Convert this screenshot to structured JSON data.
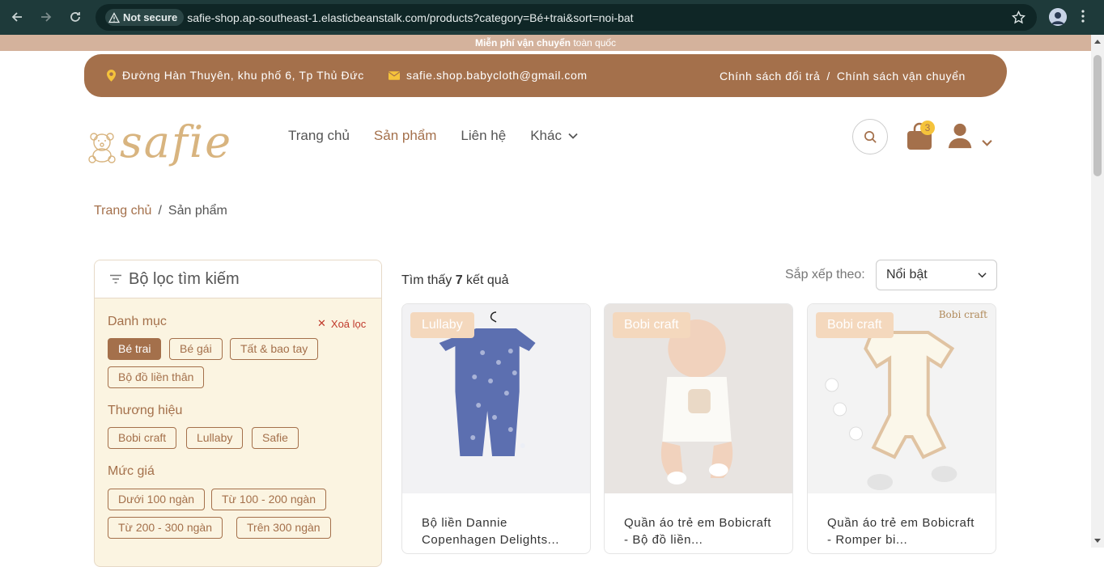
{
  "browser": {
    "security": "Not secure",
    "url": "safie-shop.ap-southeast-1.elasticbeanstalk.com/products?category=Bé+trai&sort=noi-bat"
  },
  "banner": {
    "bold": "Miễn phí vận chuyển",
    "rest": "toàn quốc"
  },
  "contact": {
    "address": "Đường Hàn Thuyên, khu phố 6, Tp Thủ Đức",
    "email": "safie.shop.babycloth@gmail.com",
    "return_policy": "Chính sách đổi trả",
    "separator": "/",
    "shipping_policy": "Chính sách vận chuyển"
  },
  "logo": "safie",
  "menu": {
    "home": "Trang chủ",
    "products": "Sản phẩm",
    "contact": "Liên hệ",
    "more": "Khác"
  },
  "cart": {
    "count": "3"
  },
  "breadcrumb": {
    "home": "Trang chủ",
    "sep": "/",
    "current": "Sản phẩm"
  },
  "filter": {
    "title": "Bộ lọc tìm kiếm",
    "category_title": "Danh mục",
    "clear": "Xoá lọc",
    "categories": [
      "Bé trai",
      "Bé gái",
      "Tất & bao tay",
      "Bộ đồ liền thân"
    ],
    "brand_title": "Thương hiệu",
    "brands": [
      "Bobi craft",
      "Lullaby",
      "Safie"
    ],
    "price_title": "Mức giá",
    "prices": [
      "Dưới 100 ngàn",
      "Từ 100 - 200 ngàn",
      "Từ 200 - 300 ngàn",
      "Trên 300 ngàn"
    ]
  },
  "results": {
    "prefix": "Tìm thấy",
    "count": "7",
    "suffix": "kết quả"
  },
  "sort": {
    "label": "Sắp xếp theo:",
    "value": "Nổi bật"
  },
  "products": [
    {
      "brand": "Lullaby",
      "name": "Bộ liền Dannie Copenhagen Delights..."
    },
    {
      "brand": "Bobi craft",
      "name": "Quần áo trẻ em Bobicraft - Bộ đồ liền..."
    },
    {
      "brand": "Bobi craft",
      "name": "Quần áo trẻ em Bobicraft - Romper bi...",
      "watermark": "Bobi craft"
    }
  ],
  "colors": {
    "brand": "#a4704b",
    "accent": "#f5c33b",
    "filter_bg": "#fbf4e1"
  }
}
